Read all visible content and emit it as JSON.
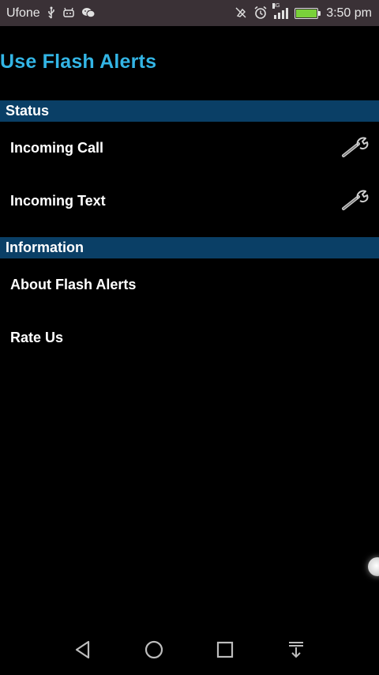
{
  "status_bar": {
    "carrier": "Ufone",
    "left_icons": [
      "usb-icon",
      "android-debug-icon",
      "wechat-icon"
    ],
    "right_icons": [
      "vibrate-off-icon",
      "alarm-icon",
      "signal-3g-icon",
      "battery-charging-icon"
    ],
    "network_tag": "3G",
    "time": "3:50 pm",
    "colors": {
      "background": "#3a3136",
      "battery_fill": "#7ad13a"
    }
  },
  "header": {
    "title": "Use Flash Alerts",
    "title_color": "#33b5e5"
  },
  "sections": {
    "status": {
      "label": "Status",
      "items": [
        {
          "label": "Incoming Call",
          "icon": "wrench-icon"
        },
        {
          "label": "Incoming Text",
          "icon": "wrench-icon"
        }
      ]
    },
    "information": {
      "label": "Information",
      "items": [
        {
          "label": "About Flash Alerts"
        },
        {
          "label": "Rate Us"
        }
      ]
    },
    "header_color": "#0a3f66"
  },
  "nav_bar": {
    "buttons": [
      "back-icon",
      "home-icon",
      "recents-icon",
      "notification-pulldown-icon"
    ]
  }
}
